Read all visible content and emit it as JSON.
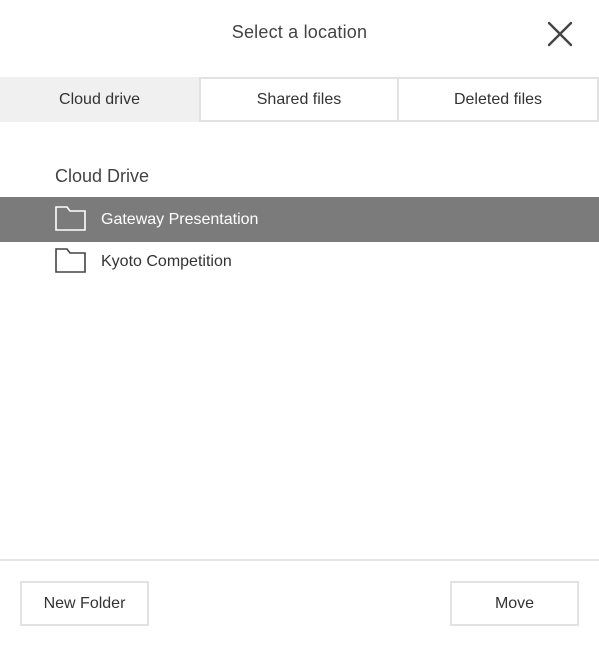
{
  "dialog": {
    "title": "Select a location",
    "close_icon": "close-icon"
  },
  "tabs": [
    {
      "label": "Cloud drive",
      "active": true
    },
    {
      "label": "Shared files",
      "active": false
    },
    {
      "label": "Deleted files",
      "active": false
    }
  ],
  "section": {
    "label": "Cloud Drive"
  },
  "folders": [
    {
      "name": "Gateway Presentation",
      "icon": "folder-icon",
      "selected": true
    },
    {
      "name": "Kyoto Competition",
      "icon": "folder-icon",
      "selected": false
    }
  ],
  "footer": {
    "new_folder_label": "New Folder",
    "move_label": "Move"
  },
  "colors": {
    "selected_row_bg": "#7b7b7b",
    "active_tab_bg": "#f0f0f0",
    "border": "#e2e2e2"
  }
}
